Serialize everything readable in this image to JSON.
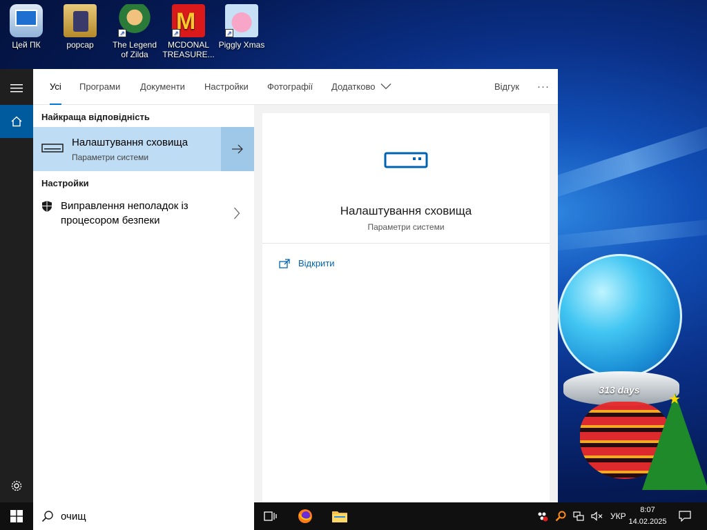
{
  "desktop": {
    "icons": [
      {
        "label": "Цей ПК"
      },
      {
        "label": "popcap"
      },
      {
        "label": "The Legend of Zilda"
      },
      {
        "label": "MCDONAL TREASURE..."
      },
      {
        "label": "Piggly Xmas"
      }
    ],
    "globe_text": "313 days"
  },
  "search": {
    "tabs": [
      "Усі",
      "Програми",
      "Документи",
      "Настройки",
      "Фотографії",
      "Додатково"
    ],
    "feedback": "Відгук",
    "more": "···",
    "best_match_heading": "Найкраща відповідність",
    "best_match": {
      "title": "Налаштування сховища",
      "subtitle": "Параметри системи"
    },
    "settings_heading": "Настройки",
    "settings_item": {
      "line1": "Виправлення неполадок із",
      "line2": "процесором безпеки"
    },
    "preview": {
      "title": "Налаштування сховища",
      "subtitle": "Параметри системи",
      "open": "Відкрити"
    },
    "query": "очищ"
  },
  "taskbar": {
    "language": "УКР",
    "time": "8:07",
    "date": "14.02.2025"
  },
  "colors": {
    "accent": "#0078d7",
    "best_bg": "#bedcf3",
    "link": "#0063b1"
  }
}
